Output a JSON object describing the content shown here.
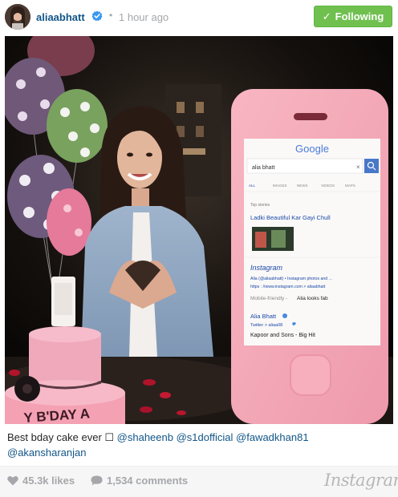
{
  "header": {
    "username": "aliaabhatt",
    "separator": "•",
    "time_ago": "1 hour ago",
    "follow_label": "Following",
    "verified_icon": "verified-badge-icon"
  },
  "photo": {
    "cake_text": "Y B'DAY A",
    "phone_screen": {
      "search_brand": "Google",
      "query": "alia bhatt",
      "clear": "×",
      "tabs": [
        "ALL",
        "IMAGES",
        "NEWS",
        "VIDEOS",
        "MAPS"
      ],
      "top_stories_label": "Top stories",
      "story_title": "Ladki Beautiful Kar Gayi Chull",
      "ig_brand": "Instagram",
      "ig_line1": "Alia (@aliaabhatt) • Instagram photos and ...",
      "ig_line2": "https : //www.instagram.com > aliaabhatt",
      "mobile_friendly": "Mobile-friendly -",
      "alia_looks_fab": "Alia looks fab",
      "profile_name": "Alia Bhatt",
      "twitter_line": "Twitter > aliaa08",
      "film": "Kapoor and Sons - Big Hit"
    }
  },
  "caption": {
    "text": "Best bday cake ever ☐ ",
    "mentions": [
      "@shaheenb",
      "@s1dofficial",
      "@fawadkhan81",
      "@akansharanjan"
    ]
  },
  "footer": {
    "likes": "45.3k likes",
    "comments": "1,534 comments",
    "brand": "Instagram"
  },
  "colors": {
    "link": "#125688",
    "follow_button": "#70c050",
    "muted": "#a5a7aa",
    "cake_pink": "#f3a1b3"
  }
}
